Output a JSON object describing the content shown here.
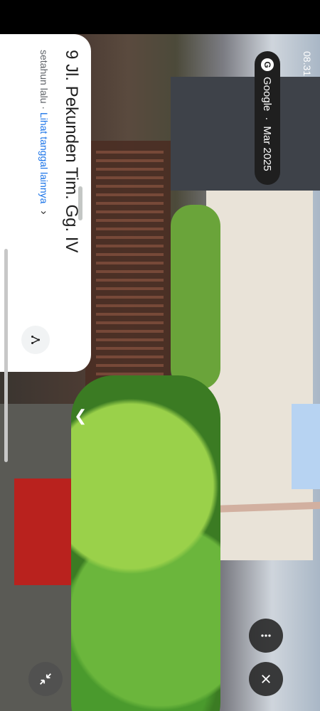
{
  "status": {
    "time": "08.31"
  },
  "place": {
    "address": "9 Jl. Pekunden Tim. Gg. IV",
    "meta_text": "setahun lalu · ",
    "link_text": "Lihat tanggal lainnya"
  },
  "imagery": {
    "provider": "Google",
    "date": "Mar 2025"
  },
  "icons": {
    "share": "share-icon",
    "chevron": "chevron-right-icon",
    "more": "more-icon",
    "close": "close-icon",
    "collapse": "collapse-icon"
  }
}
